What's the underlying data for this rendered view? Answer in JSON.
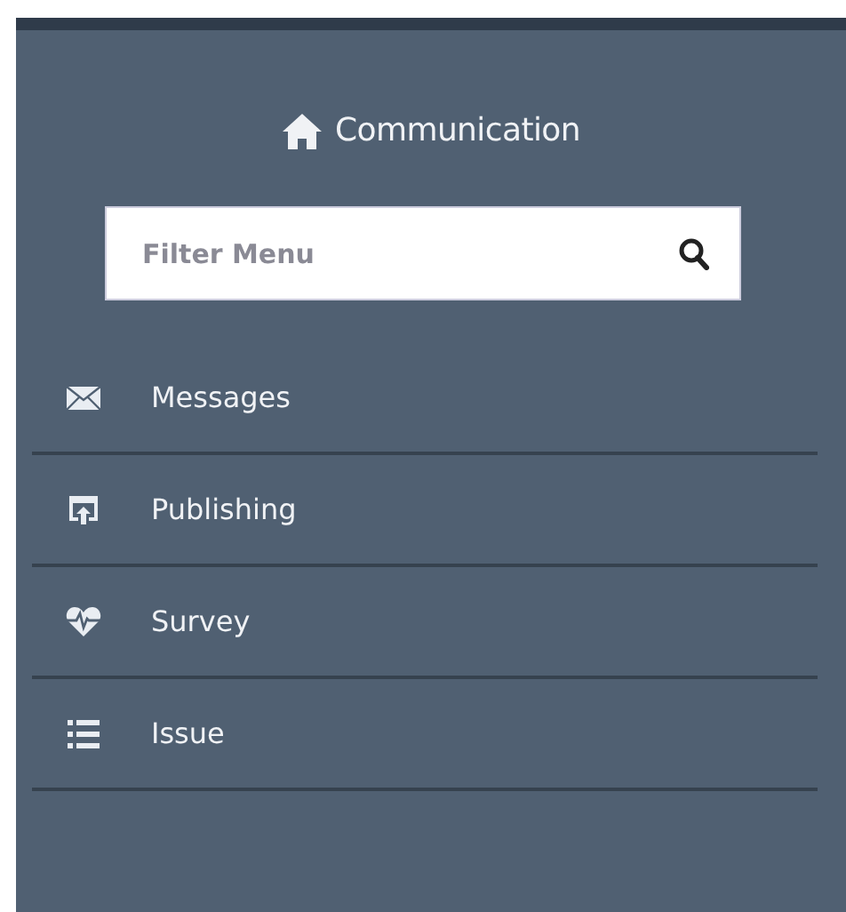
{
  "sidebar": {
    "title": "Communication",
    "search": {
      "placeholder": "Filter Menu"
    },
    "items": [
      {
        "label": "Messages"
      },
      {
        "label": "Publishing"
      },
      {
        "label": "Survey"
      },
      {
        "label": "Issue"
      }
    ]
  }
}
